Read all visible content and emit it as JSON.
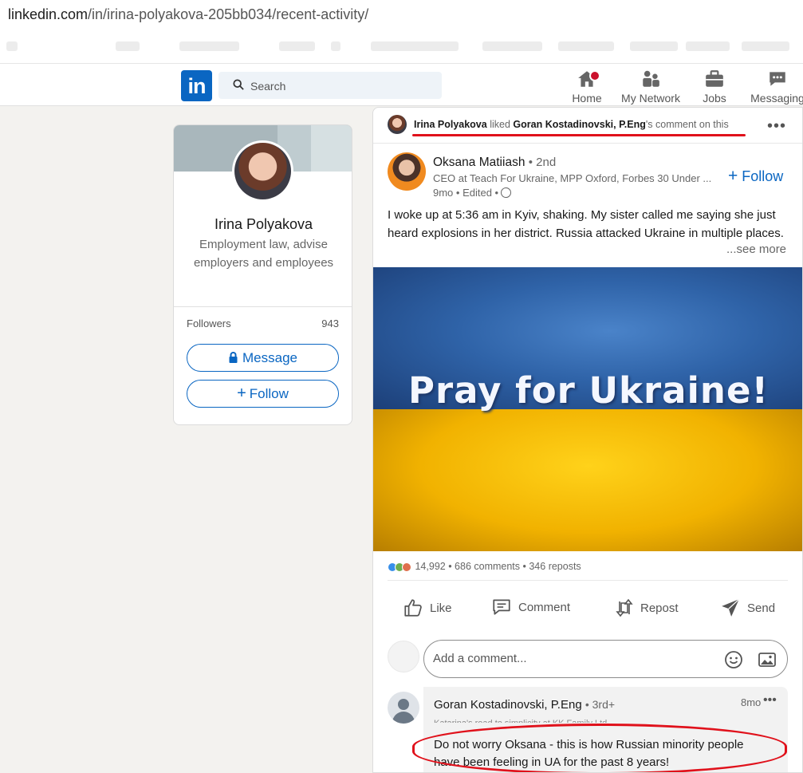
{
  "browser": {
    "url_domain": "linkedin.com",
    "url_path": "/in/irina-polyakova-205bb034/recent-activity/"
  },
  "nav": {
    "search_placeholder": "Search",
    "items": [
      {
        "label": "Home"
      },
      {
        "label": "My Network"
      },
      {
        "label": "Jobs"
      },
      {
        "label": "Messaging"
      }
    ],
    "logo_text": "in"
  },
  "profile": {
    "name": "Irina Polyakova",
    "headline": "Employment law, advise employers and employees",
    "followers_label": "Followers",
    "followers_count": "943",
    "message_label": "Message",
    "follow_label": "Follow"
  },
  "activity": {
    "actor": "Irina Polyakova",
    "verb": "liked",
    "target": "Goran Kostadinovski, P.Eng",
    "suffix": "'s comment on this"
  },
  "post": {
    "author": "Oksana Matiiash",
    "degree": "• 2nd",
    "headline": "CEO at Teach For Ukraine, MPP Oxford, Forbes 30 Under ...",
    "meta": "9mo • Edited •",
    "follow_label": "Follow",
    "text": "I woke up at 5:36 am in Kyiv, shaking. My sister called me saying she just heard explosions in her district. Russia attacked Ukraine in multiple places.",
    "see_more": "...see more",
    "image_caption": "Pray  for  Ukraine!",
    "reactions_count": "14,992",
    "comments_count": "686 comments",
    "reposts_count": "346 reposts",
    "actions": {
      "like": "Like",
      "comment": "Comment",
      "repost": "Repost",
      "send": "Send"
    },
    "comment_placeholder": "Add a comment..."
  },
  "comment": {
    "author": "Goran Kostadinovski, P.Eng",
    "degree": "• 3rd+",
    "subtitle": "Katarina's road to simplicity at KK Family Ltd",
    "time": "8mo",
    "text": "Do not worry Oksana - this is how Russian minority people have been feeling in UA for the past 8 years!"
  },
  "colors": {
    "brand": "#0a66c2",
    "annotation_red": "#e0111b",
    "ukraine_blue": "#2f63a8",
    "ukraine_yellow": "#f1b200"
  }
}
